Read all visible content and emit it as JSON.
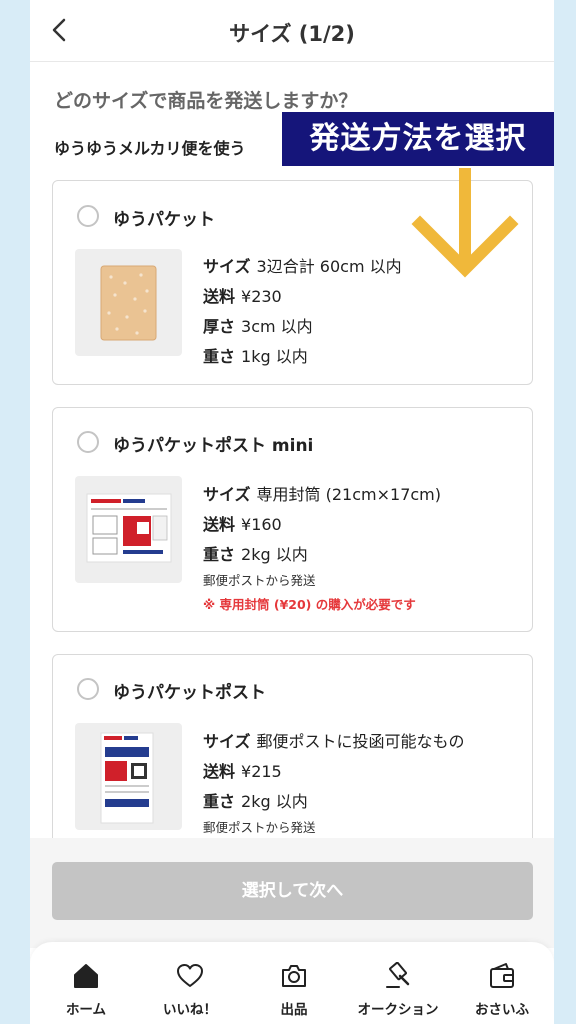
{
  "header": {
    "title": "サイズ (1/2)"
  },
  "question": "どのサイズで商品を発送しますか？",
  "section_label": "ゆうゆうメルカリ便を使う",
  "overlay_label": "発送方法を選択",
  "colors": {
    "accent_arrow": "#f0b83a",
    "overlay_bg": "#15157a",
    "warning": "#e5383b",
    "disabled_button": "#c4c4c4"
  },
  "options": [
    {
      "title": "ゆうパケット",
      "size_label": "サイズ",
      "size_value": "3辺合計 60cm 以内",
      "fee_label": "送料",
      "fee_value": "¥230",
      "thickness_label": "厚さ",
      "thickness_value": "3cm 以内",
      "weight_label": "重さ",
      "weight_value": "1kg 以内"
    },
    {
      "title": "ゆうパケットポスト mini",
      "size_label": "サイズ",
      "size_value": "専用封筒 (21cm×17cm)",
      "fee_label": "送料",
      "fee_value": "¥160",
      "weight_label": "重さ",
      "weight_value": "2kg 以内",
      "note": "郵便ポストから発送",
      "warning": "※ 専用封筒 (¥20) の購入が必要です"
    },
    {
      "title": "ゆうパケットポスト",
      "size_label": "サイズ",
      "size_value": "郵便ポストに投函可能なもの",
      "fee_label": "送料",
      "fee_value": "¥215",
      "weight_label": "重さ",
      "weight_value": "2kg 以内",
      "note": "郵便ポストから発送"
    }
  ],
  "next_button": "選択して次へ",
  "tabs": [
    {
      "label": "ホーム",
      "icon": "home-icon"
    },
    {
      "label": "いいね！",
      "icon": "heart-icon"
    },
    {
      "label": "出品",
      "icon": "camera-icon"
    },
    {
      "label": "オークション",
      "icon": "gavel-icon"
    },
    {
      "label": "おさいふ",
      "icon": "wallet-icon"
    }
  ]
}
